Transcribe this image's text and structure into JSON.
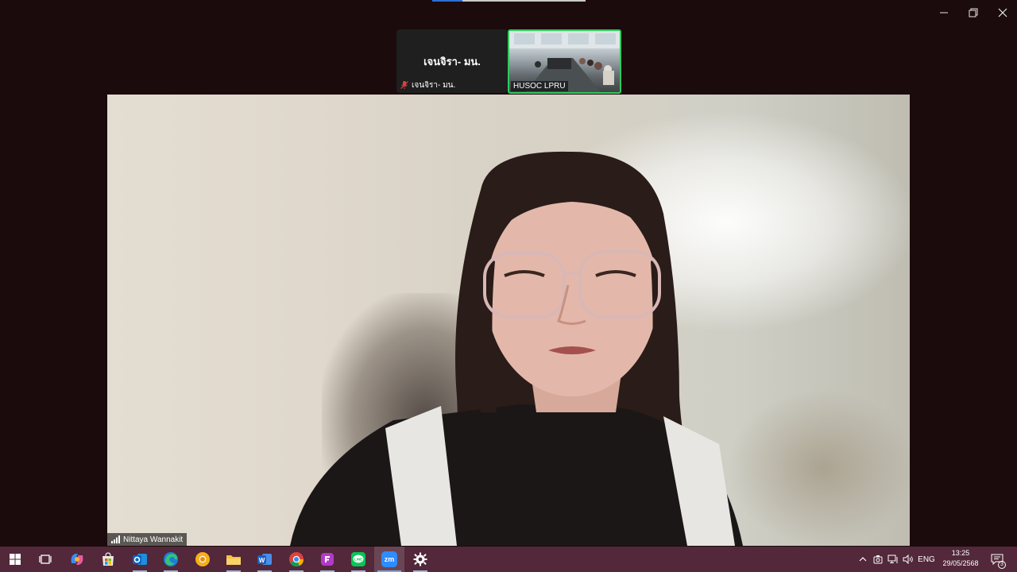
{
  "window": {
    "minimize_icon": "minimize-icon",
    "restore_icon": "restore-icon",
    "close_icon": "close-icon"
  },
  "gallery": {
    "participant_name_tile": {
      "display_name": "เจนจิรา- มน.",
      "label": "เจนจิรา- มน.",
      "muted_icon": "mic-muted-icon"
    },
    "participant_video_tile": {
      "label": "HUSOC LPRU",
      "active_speaker_border": "#2fcc5b"
    }
  },
  "main_video": {
    "speaker_name": "Nittaya Wannakit",
    "signal_icon": "signal-bars-icon"
  },
  "taskbar": {
    "background": "#52283a",
    "items": [
      {
        "name": "start",
        "icon": "windows-start-icon"
      },
      {
        "name": "task-view",
        "icon": "task-view-icon"
      },
      {
        "name": "copilot",
        "icon": "copilot-icon"
      },
      {
        "name": "store",
        "icon": "microsoft-store-icon"
      },
      {
        "name": "outlook",
        "icon": "outlook-icon"
      },
      {
        "name": "edge",
        "icon": "edge-icon"
      },
      {
        "name": "chrome-canary",
        "icon": "chrome-yellow-icon"
      },
      {
        "name": "file-explorer",
        "icon": "folder-icon"
      },
      {
        "name": "word",
        "icon": "word-icon"
      },
      {
        "name": "chrome",
        "icon": "chrome-icon"
      },
      {
        "name": "pdf-app",
        "icon": "pdf-app-icon"
      },
      {
        "name": "line",
        "icon": "line-icon"
      },
      {
        "name": "zoom",
        "icon": "zoom-icon",
        "label": "zm"
      },
      {
        "name": "settings",
        "icon": "gear-icon"
      }
    ],
    "tray": {
      "chevron_icon": "chevron-up-icon",
      "meet_icon": "camera-tray-icon",
      "network_icon": "network-icon",
      "volume_icon": "volume-icon",
      "language": "ENG",
      "time": "13:25",
      "date": "29/05/2568",
      "notifications_icon": "notification-icon",
      "notification_count": "3"
    }
  }
}
